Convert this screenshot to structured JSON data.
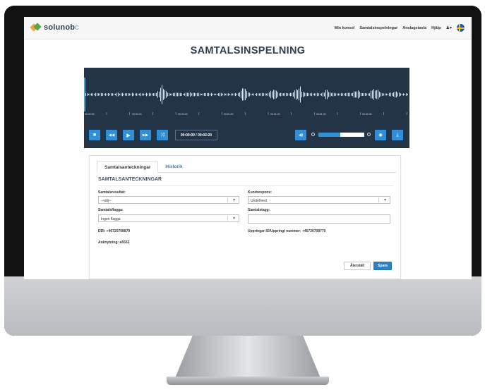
{
  "app": {
    "logo_main": "solunob",
    "logo_suffix": "c"
  },
  "nav": {
    "items": [
      "Min konsol",
      "Samtalsinspelningar",
      "Anslagstavla",
      "Hjälp"
    ],
    "user_icon": "user-icon",
    "user_glyph": "♟▾",
    "flag_icon": "swedish-flag-icon"
  },
  "page": {
    "title": "SAMTALSINSPELNING"
  },
  "player": {
    "time": "00:00:00 / 00:02:20",
    "ticks": [
      "00:00:00",
      "00:00:20",
      "00:00:40",
      "00:01:00",
      "00:01:20",
      "00:01:40",
      "00:02:00"
    ],
    "zoom_level": 0.47,
    "controls": {
      "stop_glyph": "■",
      "rewind_glyph": "◀◀",
      "play_glyph": "▶",
      "forward_glyph": "▶▶",
      "shuffle_glyph": "⤨",
      "volume_glyph": "◀)",
      "settings_glyph": "✹",
      "download_glyph": "⤓"
    }
  },
  "tabs": [
    {
      "label": "Samtalsanteckningar",
      "active": true
    },
    {
      "label": "Historik",
      "active": false
    }
  ],
  "form": {
    "section_title": "SAMTALSANTECKNINGAR",
    "samtalsresultat": {
      "label": "Samtalsresultat:",
      "value": "--välj--"
    },
    "kundrespons": {
      "label": "Kundrespons:",
      "value": "Undefined"
    },
    "samtalsflagga": {
      "label": "Samtalsflagga:",
      "value": "Ingen flagga"
    },
    "samtalstagg": {
      "label": "Samtalstagg:",
      "value": ""
    },
    "caret": "▼",
    "ddi": "DDI: +46720708879",
    "uppringare": "Uppringar-ID/Uppringt nummer: +46720708770",
    "anknytning": "Anknytning: a5552",
    "reset_label": "Återställ",
    "save_label": "Spara"
  },
  "colors": {
    "player_bg": "#243447",
    "accent": "#2f8fd8",
    "title": "#2f3f52"
  }
}
